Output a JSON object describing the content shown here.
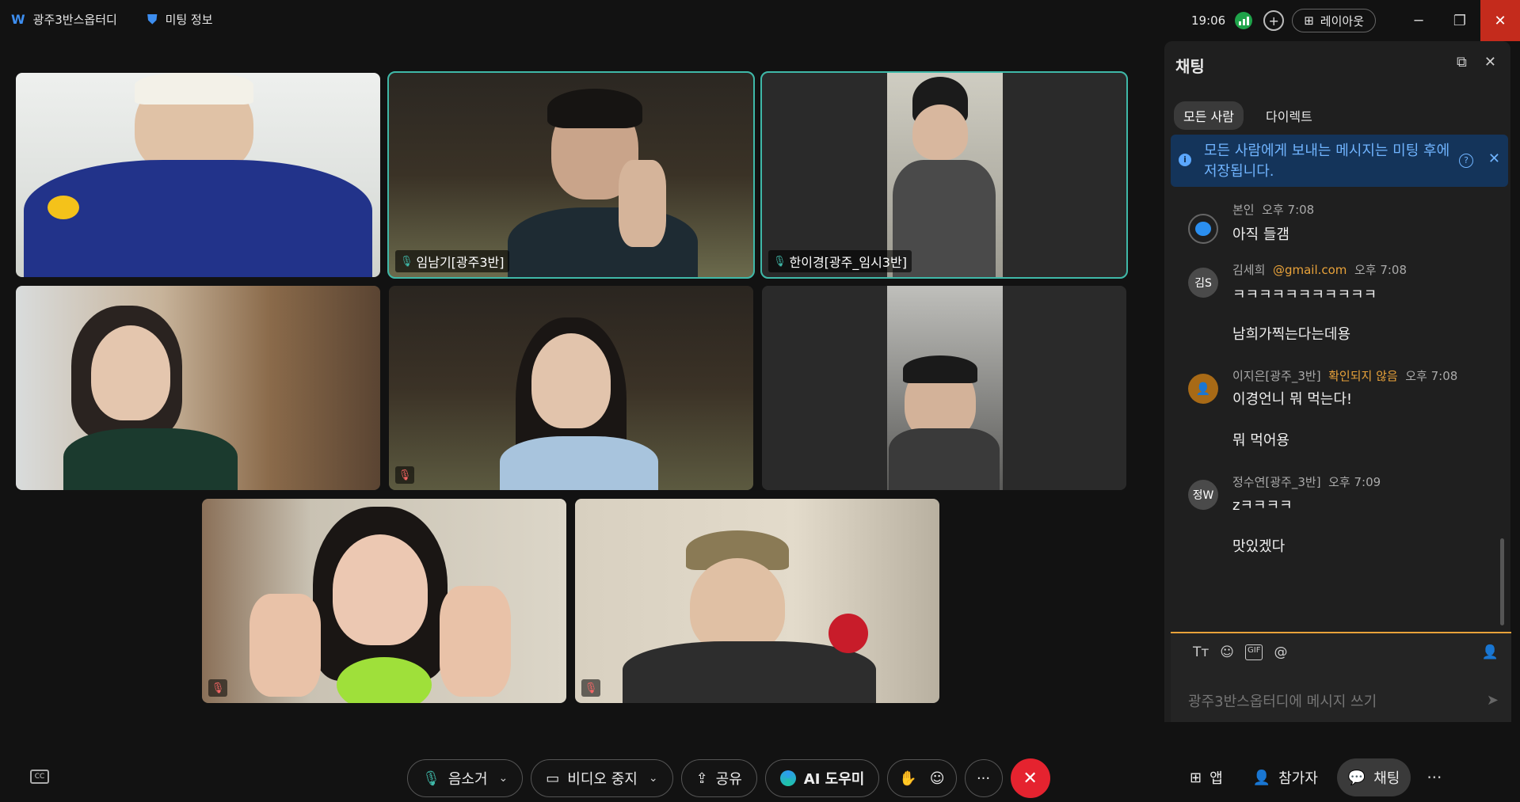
{
  "titlebar": {
    "meeting_name": "광주3반스옵터디",
    "meeting_info": "미팅 정보",
    "time": "19:06",
    "layout_label": "레이아웃"
  },
  "tiles": [
    {
      "name": "",
      "muted": false
    },
    {
      "name": "임남기[광주3반]",
      "muted": false
    },
    {
      "name": "한이경[광주_임시3반]",
      "muted": false
    },
    {
      "name": "",
      "muted": false
    },
    {
      "name": "",
      "muted": true
    },
    {
      "name": "",
      "muted": false
    },
    {
      "name": "",
      "muted": true
    },
    {
      "name": "",
      "muted": true
    }
  ],
  "chat": {
    "title": "채팅",
    "tabs": [
      "모든 사람",
      "다이렉트"
    ],
    "notice": "모든 사람에게 보내는 메시지는 미팅 후에 저장됩니다.",
    "messages": [
      {
        "sender": "본인",
        "time": "오후 7:08",
        "lines": [
          "아직 들갬"
        ],
        "avatar": ""
      },
      {
        "sender": "김세희",
        "email": "@gmail.com",
        "time": "오후 7:08",
        "lines": [
          "ㅋㅋㅋㅋㅋㅋㅋㅋㅋㅋㅋ",
          "남희가찍는다는데용"
        ],
        "avatar": "김S"
      },
      {
        "sender": "이지은[광주_3반]",
        "status": "확인되지 않음",
        "time": "오후 7:08",
        "lines": [
          "이경언니 뭐 먹는다!",
          "뭐 먹어용"
        ],
        "avatar": ""
      },
      {
        "sender": "정수연[광주_3반]",
        "time": "오후 7:09",
        "lines": [
          "zㅋㅋㅋㅋ",
          "맛있겠다"
        ],
        "avatar": "정W"
      }
    ],
    "input_placeholder": "광주3반스옵터디에 메시지 쓰기"
  },
  "controls": {
    "mute": "음소거",
    "video": "비디오 중지",
    "share": "공유",
    "ai": "AI 도우미",
    "apps": "앱",
    "participants": "참가자",
    "chat": "채팅"
  }
}
